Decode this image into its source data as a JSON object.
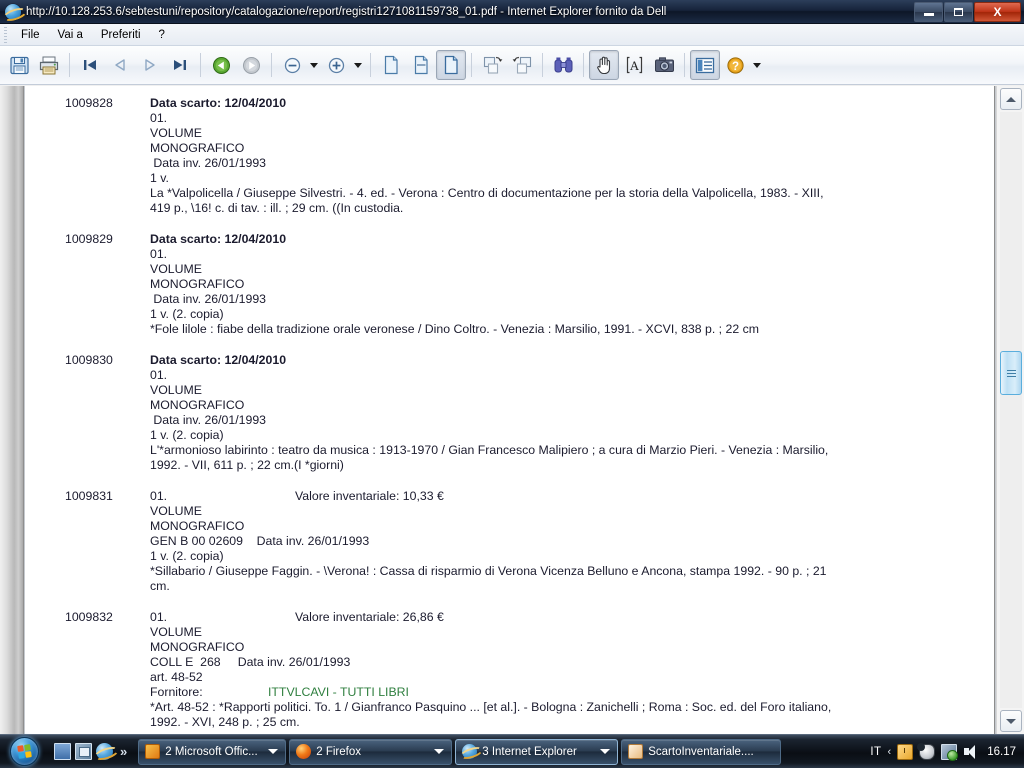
{
  "window": {
    "title": "http://10.128.253.6/sebtestuni/repository/catalogazione/report/registri1271081159738_01.pdf - Internet Explorer fornito da Dell",
    "browser_icon": "internet-explorer-icon",
    "minimize_label": "Riduci a icona",
    "restore_label": "Ripristina",
    "close_label": "Chiudi"
  },
  "menubar": {
    "items": [
      {
        "label": "File"
      },
      {
        "label": "Vai a"
      },
      {
        "label": "Preferiti"
      },
      {
        "label": "?"
      }
    ]
  },
  "toolbar": {
    "buttons": [
      {
        "name": "save-button",
        "icon": "floppy-disk-icon",
        "pressed": false
      },
      {
        "name": "print-button",
        "icon": "printer-icon",
        "pressed": false
      },
      {
        "name": "first-page-button",
        "icon": "skip-to-start-icon",
        "pressed": false
      },
      {
        "name": "previous-page-button",
        "icon": "triangle-left-icon",
        "pressed": false
      },
      {
        "name": "next-page-button",
        "icon": "triangle-right-icon",
        "pressed": false
      },
      {
        "name": "last-page-button",
        "icon": "skip-to-end-icon",
        "pressed": false
      },
      {
        "name": "previous-view-button",
        "icon": "green-back-arrow-icon",
        "pressed": false
      },
      {
        "name": "next-view-button",
        "icon": "grey-forward-arrow-icon",
        "pressed": false
      },
      {
        "name": "zoom-out-button",
        "icon": "minus-circle-icon",
        "pressed": false
      },
      {
        "name": "zoom-in-button",
        "icon": "plus-circle-icon",
        "pressed": false
      },
      {
        "name": "actual-size-button",
        "icon": "page-icon",
        "pressed": false
      },
      {
        "name": "fit-width-button",
        "icon": "page-width-icon",
        "pressed": false
      },
      {
        "name": "fit-page-button",
        "icon": "page-fit-icon",
        "pressed": true
      },
      {
        "name": "rotate-clockwise-button",
        "icon": "rotate-cw-icon",
        "pressed": false
      },
      {
        "name": "rotate-counterclockwise-button",
        "icon": "rotate-ccw-icon",
        "pressed": false
      },
      {
        "name": "find-button",
        "icon": "binoculars-icon",
        "pressed": false
      },
      {
        "name": "hand-tool-button",
        "icon": "hand-icon",
        "pressed": true
      },
      {
        "name": "select-text-button",
        "icon": "text-select-icon",
        "pressed": false
      },
      {
        "name": "snapshot-button",
        "icon": "camera-icon",
        "pressed": false
      },
      {
        "name": "show-navigation-pane-button",
        "icon": "navigation-pane-icon",
        "pressed": true
      },
      {
        "name": "help-button",
        "icon": "question-mark-icon",
        "pressed": false
      }
    ]
  },
  "document": {
    "records": [
      {
        "id": "1009828",
        "head_left": "Data scarto: 12/04/2010",
        "head_left_bold": true,
        "head_right": "",
        "lines": [
          "01.",
          "VOLUME",
          "MONOGRAFICO",
          " Data inv. 26/01/1993",
          "1 v.",
          "La *Valpolicella / Giuseppe Silvestri. - 4. ed. - Verona : Centro di documentazione per la storia della Valpolicella, 1983. - XIII,",
          "419 p., \\16! c. di tav. : ill. ; 29 cm. ((In custodia."
        ]
      },
      {
        "id": "1009829",
        "head_left": "Data scarto: 12/04/2010",
        "head_left_bold": true,
        "head_right": "",
        "lines": [
          "01.",
          "VOLUME",
          "MONOGRAFICO",
          " Data inv. 26/01/1993",
          "1 v. (2. copia)",
          "*Fole lilole : fiabe della tradizione orale veronese / Dino Coltro. - Venezia : Marsilio, 1991. - XCVI, 838 p. ; 22 cm"
        ]
      },
      {
        "id": "1009830",
        "head_left": "Data scarto: 12/04/2010",
        "head_left_bold": true,
        "head_right": "",
        "lines": [
          "01.",
          "VOLUME",
          "MONOGRAFICO",
          " Data inv. 26/01/1993",
          "1 v. (2. copia)",
          "L'*armonioso labirinto : teatro da musica : 1913-1970 / Gian Francesco Malipiero ; a cura di Marzio Pieri. - Venezia : Marsilio,",
          "1992. - VII, 611 p. ; 22 cm.(I *giorni)"
        ]
      },
      {
        "id": "1009831",
        "head_left": "01.",
        "head_left_bold": false,
        "head_right": "Valore inventariale: 10,33 €",
        "lines": [
          "VOLUME",
          "MONOGRAFICO",
          "GEN B 00 02609    Data inv. 26/01/1993",
          "1 v. (2. copia)",
          "*Sillabario / Giuseppe Faggin. - \\Verona! : Cassa di risparmio di Verona Vicenza Belluno e Ancona, stampa 1992. - 90 p. ; 21",
          "cm."
        ]
      },
      {
        "id": "1009832",
        "head_left": "01.",
        "head_left_bold": false,
        "head_right": "Valore inventariale: 26,86 €",
        "lines": [
          "VOLUME",
          "MONOGRAFICO",
          "COLL E  268     Data inv. 26/01/1993",
          "art. 48-52",
          "Fornitore:   ITTVLCAVI - TUTTI LIBRI",
          "*Art. 48-52 : *Rapporti politici. To. 1 / Gianfranco Pasquino ... [et al.]. - Bologna : Zanichelli ; Roma : Soc. ed. del Foro italiano,",
          "1992. - XVI, 248 p. ; 25 cm."
        ],
        "supplier_highlighted": "ITTVLCAVI - TUTTI LIBRI",
        "supplier_label": "Fornitore:"
      }
    ]
  },
  "scrollbar": {
    "up_label": "Scorri su",
    "down_label": "Scorri giù",
    "thumb_label": "Barra di scorrimento verticale"
  },
  "taskbar": {
    "start_label": "Start",
    "quicklaunch": [
      {
        "name": "show-desktop-icon",
        "label": "Mostra desktop"
      },
      {
        "name": "switch-windows-icon",
        "label": "Cambia finestra"
      },
      {
        "name": "internet-explorer-icon",
        "label": "Internet Explorer"
      }
    ],
    "overflow_label": "»",
    "tasks": [
      {
        "label": "2 Microsoft Offic...",
        "icon": "office-icon",
        "active": false,
        "has_caret": true
      },
      {
        "label": "2 Firefox",
        "icon": "firefox-icon",
        "active": false,
        "has_caret": true
      },
      {
        "label": "3 Internet Explorer",
        "icon": "internet-explorer-icon",
        "active": true,
        "has_caret": true
      },
      {
        "label": "ScartoInventariale....",
        "icon": "document-icon",
        "active": false,
        "has_caret": false
      }
    ],
    "tray": {
      "language": "IT",
      "chevron": "‹",
      "icons": [
        "clock-icon",
        "mouse-icon",
        "network-icon",
        "volume-icon"
      ],
      "time": "16.17"
    }
  },
  "colors": {
    "titlebar_dark": "#16233a",
    "close_red": "#bf3418",
    "text_navy": "#1b1b2e",
    "highlight_green": "#2f7f3f",
    "highlight_orange": "#b06a1c",
    "page_white": "#ffffff",
    "viewport_grey": "#c5c9ce"
  }
}
